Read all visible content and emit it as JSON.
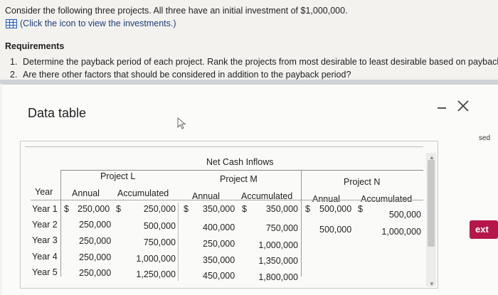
{
  "question": {
    "text": "Consider the following three projects. All three have an initial investment of $1,000,000.",
    "link_text": "(Click the icon to view the investments.)"
  },
  "requirements": {
    "title": "Requirements",
    "items": [
      {
        "num": "1.",
        "text": "Determine the payback period of each project. Rank the projects from most desirable to least desirable based on payback"
      },
      {
        "num": "2.",
        "text": "Are there other factors that should be considered in addition to the payback period?"
      }
    ]
  },
  "modal": {
    "title": "Data table",
    "right_peek_text": "sed",
    "next_label": "ext"
  },
  "table": {
    "group_header": "Net Cash Inflows",
    "projects": [
      "Project L",
      "Project M",
      "Project N"
    ],
    "year_header": "Year",
    "annual_header": "Annual",
    "accumulated_header": "Accumulated",
    "rows": [
      {
        "year": "Year 1",
        "l_sign": "$",
        "l_annual": "250,000",
        "l_acc_sign": "$",
        "l_acc": "250,000",
        "m_sign": "$",
        "m_annual": "350,000",
        "m_acc_sign": "$",
        "m_acc": "350,000",
        "n_sign": "$",
        "n_annual": "500,000",
        "n_acc_sign": "$",
        "n_acc": "500,000"
      },
      {
        "year": "Year 2",
        "l_annual": "250,000",
        "l_acc": "500,000",
        "m_annual": "400,000",
        "m_acc": "750,000",
        "n_annual": "500,000",
        "n_acc": "1,000,000"
      },
      {
        "year": "Year 3",
        "l_annual": "250,000",
        "l_acc": "750,000",
        "m_annual": "250,000",
        "m_acc": "1,000,000"
      },
      {
        "year": "Year 4",
        "l_annual": "250,000",
        "l_acc": "1,000,000",
        "m_annual": "350,000",
        "m_acc": "1,350,000"
      },
      {
        "year": "Year 5",
        "l_annual": "250,000",
        "l_acc": "1,250,000",
        "m_annual": "450,000",
        "m_acc": "1,800,000"
      }
    ]
  }
}
